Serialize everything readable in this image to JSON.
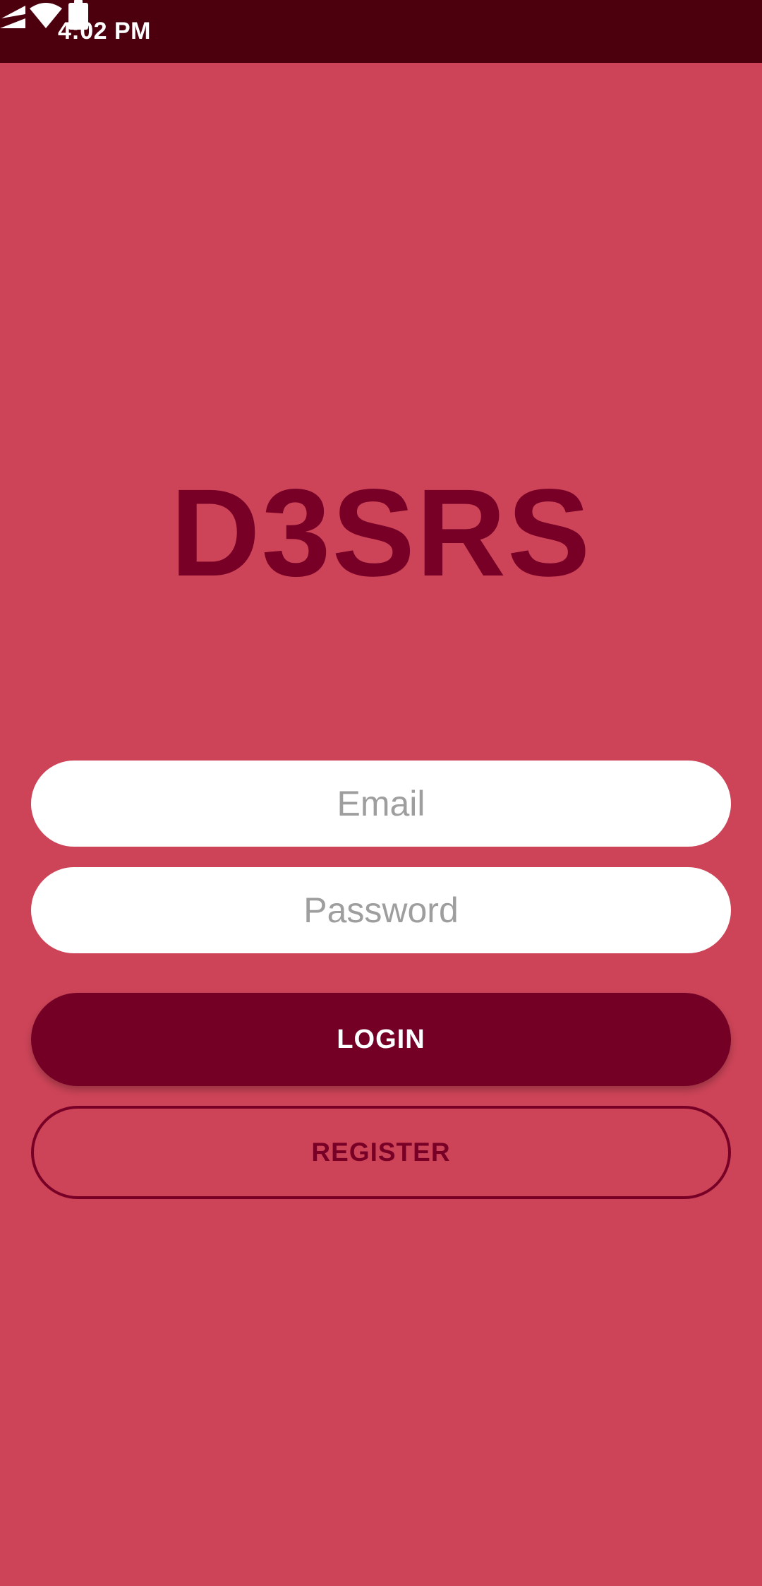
{
  "status_bar": {
    "time": "4:02 PM",
    "battery_level": "70",
    "icons": [
      "signal-icon",
      "wifi-icon",
      "battery-icon"
    ]
  },
  "app": {
    "title": "D3SRS"
  },
  "form": {
    "email_placeholder": "Email",
    "password_placeholder": "Password",
    "login_label": "LOGIN",
    "register_label": "REGISTER"
  },
  "colors": {
    "background": "#cd4458",
    "status_bar": "#4c000e",
    "primary": "#780026",
    "field_background": "#ffffff",
    "placeholder": "#9e9e9e"
  }
}
